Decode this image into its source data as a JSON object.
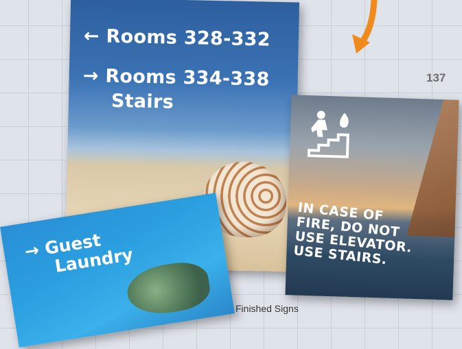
{
  "page_number": "137",
  "caption": "Finished Signs",
  "signs": {
    "rooms": {
      "line1": "← Rooms 328-332",
      "line2": "→ Rooms 334-338",
      "line3": "Stairs"
    },
    "fire": {
      "line1": "IN CASE OF",
      "line2": "FIRE, DO NOT",
      "line3": "USE ELEVATOR.",
      "line4": "USE STAIRS."
    },
    "laundry": {
      "line1": "→ Guest",
      "line2": "Laundry"
    }
  },
  "icons": {
    "arrow": "orange-curved-arrow",
    "fire_stairs": "person-stairs-fire-icon"
  },
  "colors": {
    "arrow": "#f08a1c",
    "background": "#dfe3ea"
  }
}
